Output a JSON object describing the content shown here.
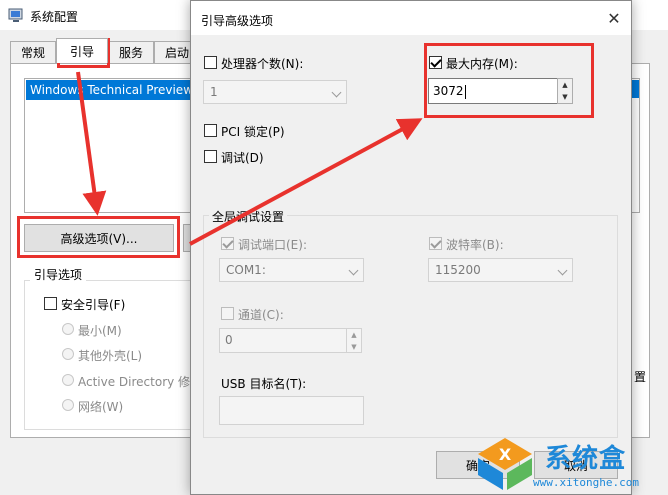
{
  "background_window": {
    "title": "系统配置",
    "tabs": [
      {
        "label": "常规"
      },
      {
        "label": "引导"
      },
      {
        "label": "服务"
      },
      {
        "label": "启动"
      }
    ],
    "os_list": [
      "Windows Technical Preview"
    ],
    "advanced_button": "高级选项(V)...",
    "boot_options_group": "引导选项",
    "safe_boot": {
      "label": "安全引导(F)",
      "checked": false
    },
    "safe_boot_modes": [
      {
        "label": "最小(M)"
      },
      {
        "label": "其他外壳(L)"
      },
      {
        "label": "Active Directory 修复"
      },
      {
        "label": "网络(W)"
      }
    ],
    "right_edge_char": "置"
  },
  "dialog": {
    "title": "引导高级选项",
    "close_icon": "close-icon",
    "processors": {
      "label": "处理器个数(N):",
      "checked": false,
      "value": "1"
    },
    "max_memory": {
      "label": "最大内存(M):",
      "checked": true,
      "value": "3072"
    },
    "pci_lock": {
      "label": "PCI 锁定(P)",
      "checked": false
    },
    "debug": {
      "label": "调试(D)",
      "checked": false
    },
    "global_debug_group": "全局调试设置",
    "debug_port": {
      "label": "调试端口(E):",
      "checked": true,
      "value": "COM1:"
    },
    "baud_rate": {
      "label": "波特率(B):",
      "checked": true,
      "value": "115200"
    },
    "channel": {
      "label": "通道(C):",
      "checked": false,
      "value": "0"
    },
    "usb_target": {
      "label": "USB 目标名(T):",
      "value": ""
    },
    "ok_button": "确定",
    "cancel_button": "取消"
  },
  "watermark": {
    "text": "系统盒",
    "url": "www.xitonghe.com"
  },
  "colors": {
    "highlight": "#e8322d",
    "selection": "#0078d7",
    "watermark": "#1e88d8"
  }
}
